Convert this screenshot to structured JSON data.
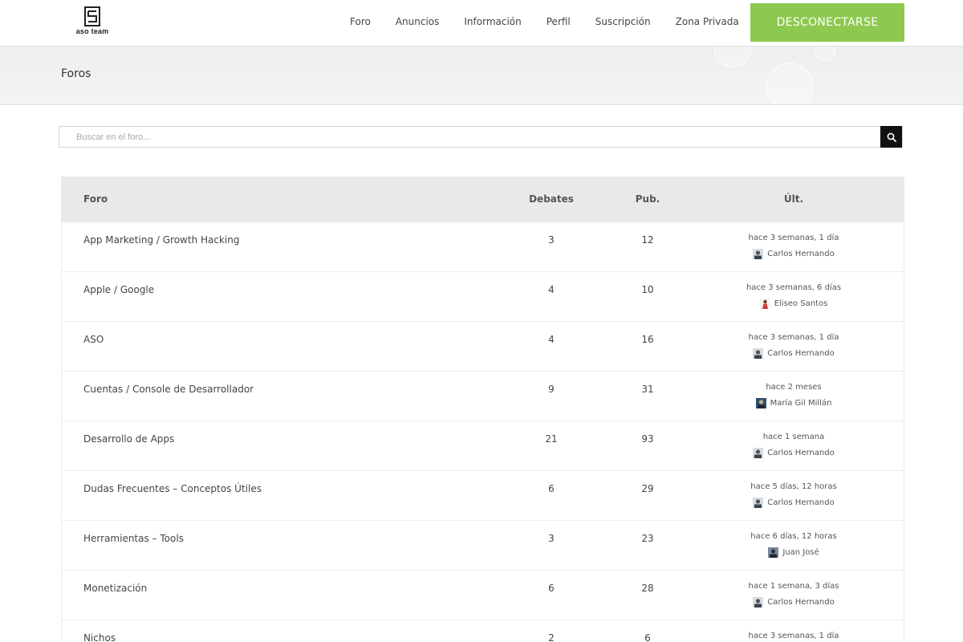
{
  "header": {
    "logo_text": "aso team",
    "nav": [
      "Foro",
      "Anuncios",
      "Información",
      "Perfil",
      "Suscripción",
      "Zona Privada"
    ],
    "logout_label": "DESCONECTARSE"
  },
  "page": {
    "title": "Foros"
  },
  "search": {
    "placeholder": "Buscar en el foro..."
  },
  "table": {
    "headers": {
      "forum": "Foro",
      "topics": "Debates",
      "posts": "Pub.",
      "last": "Últ."
    },
    "rows": [
      {
        "name": "App Marketing / Growth Hacking",
        "topics": "3",
        "posts": "12",
        "when": "hace 3 semanas, 1 día",
        "user": "Carlos Hernando"
      },
      {
        "name": "Apple / Google",
        "topics": "4",
        "posts": "10",
        "when": "hace 3 semanas, 6 días",
        "user": "Eliseo Santos"
      },
      {
        "name": "ASO",
        "topics": "4",
        "posts": "16",
        "when": "hace 3 semanas, 1 día",
        "user": "Carlos Hernando"
      },
      {
        "name": "Cuentas / Console de Desarrollador",
        "topics": "9",
        "posts": "31",
        "when": "hace 2 meses",
        "user": "María Gil Millán"
      },
      {
        "name": "Desarrollo de Apps",
        "topics": "21",
        "posts": "93",
        "when": "hace 1 semana",
        "user": "Carlos Hernando"
      },
      {
        "name": "Dudas Frecuentes – Conceptos Útiles",
        "topics": "6",
        "posts": "29",
        "when": "hace 5 días, 12 horas",
        "user": "Carlos Hernando"
      },
      {
        "name": "Herramientas – Tools",
        "topics": "3",
        "posts": "23",
        "when": "hace 6 días, 12 horas",
        "user": "Juan José"
      },
      {
        "name": "Monetización",
        "topics": "6",
        "posts": "28",
        "when": "hace 1 semana, 3 días",
        "user": "Carlos Hernando"
      },
      {
        "name": "Nichos",
        "topics": "2",
        "posts": "6",
        "when": "hace 3 semanas, 1 día",
        "user": ""
      }
    ]
  },
  "colors": {
    "accent": "#8dc94f",
    "header_row": "#e9e9e9",
    "search_button": "#111111"
  }
}
